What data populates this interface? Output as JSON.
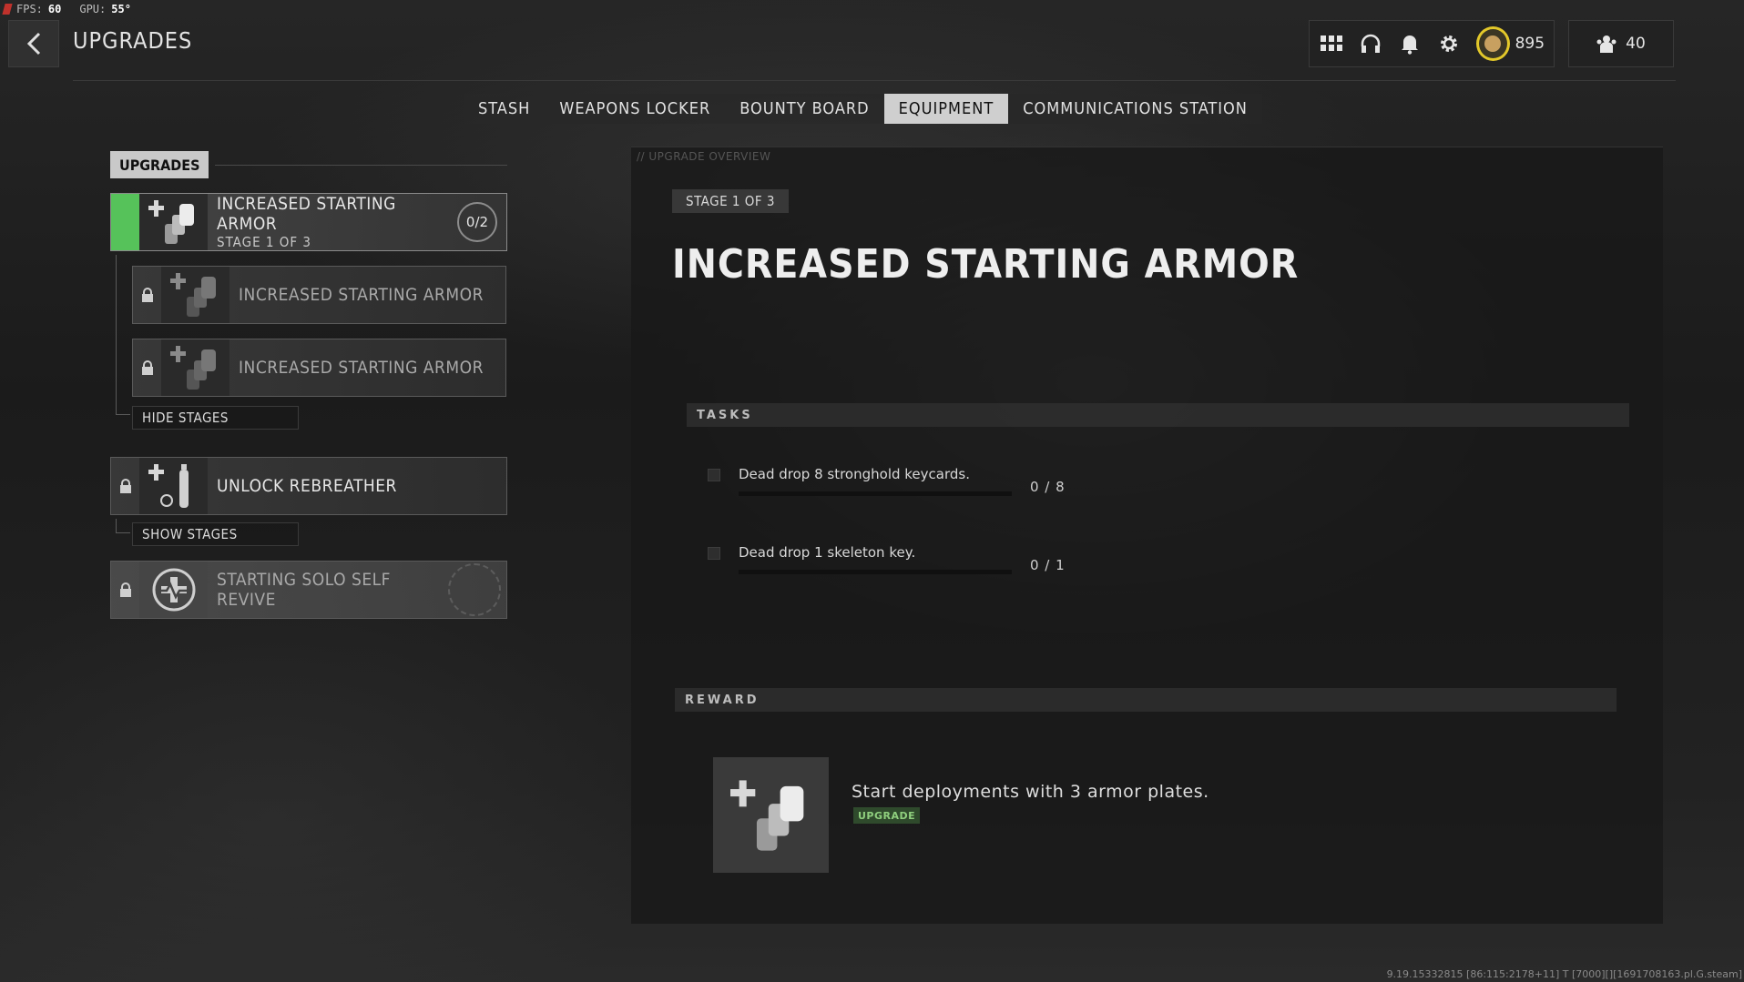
{
  "perf": {
    "fps_label": "FPS:",
    "fps_value": "60",
    "gpu_label": "GPU:",
    "gpu_value": "55°"
  },
  "header": {
    "title": "UPGRADES",
    "coins": "895",
    "party_count": "40"
  },
  "tabs": [
    {
      "label": "STASH",
      "active": false
    },
    {
      "label": "WEAPONS LOCKER",
      "active": false
    },
    {
      "label": "BOUNTY BOARD",
      "active": false
    },
    {
      "label": "EQUIPMENT",
      "active": true
    },
    {
      "label": "COMMUNICATIONS STATION",
      "active": false
    }
  ],
  "sidebar": {
    "section_label": "UPGRADES",
    "items": [
      {
        "name": "INCREASED STARTING ARMOR",
        "stage": "STAGE 1 OF 3",
        "count": "0/2",
        "state": "active"
      },
      {
        "name": "INCREASED STARTING ARMOR",
        "state": "locked"
      },
      {
        "name": "INCREASED STARTING ARMOR",
        "state": "locked"
      },
      {
        "name": "UNLOCK REBREATHER",
        "state": "locked"
      },
      {
        "name": "STARTING SOLO SELF REVIVE",
        "state": "locked"
      }
    ],
    "hide_stages": "HIDE STAGES",
    "show_stages": "SHOW STAGES"
  },
  "detail": {
    "tag": "// UPGRADE OVERVIEW",
    "stage": "STAGE 1 OF 3",
    "title": "INCREASED STARTING ARMOR",
    "tasks_label": "TASKS",
    "tasks": [
      {
        "text": "Dead drop 8 stronghold keycards.",
        "progress": "0 / 8",
        "fraction": 0
      },
      {
        "text": "Dead drop 1 skeleton key.",
        "progress": "0 / 1",
        "fraction": 0
      }
    ],
    "reward_label": "REWARD",
    "reward_text": "Start deployments with 3 armor plates.",
    "reward_badge": "UPGRADE"
  },
  "build_string": "9.19.15332815 [86:115:2178+11] T [7000][][1691708163.pl.G.steam]",
  "colors": {
    "accent_green": "#56c25a",
    "coin_yellow": "#e3c82a",
    "tab_active_bg": "#cfcfcf"
  }
}
